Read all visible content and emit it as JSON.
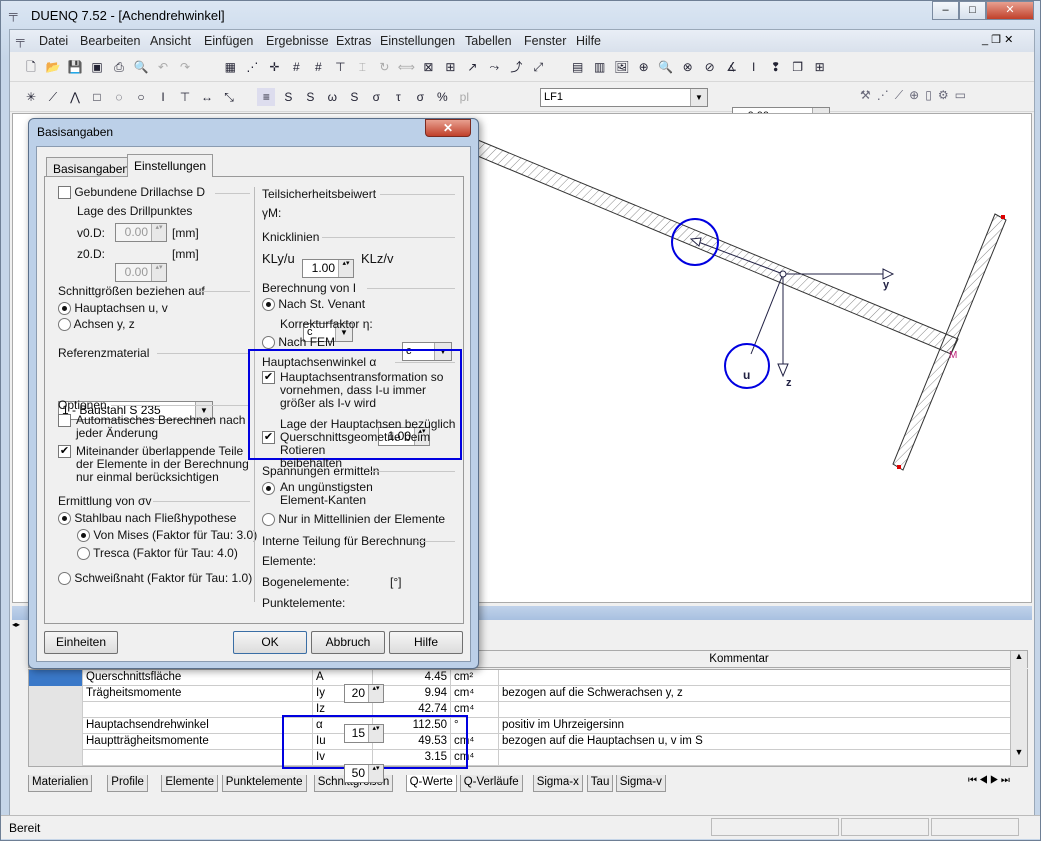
{
  "window": {
    "title": "DUENQ 7.52 - [Achendrehwinkel]",
    "controls": [
      "–",
      "□",
      "✕"
    ]
  },
  "menu": [
    "Datei",
    "Bearbeiten",
    "Ansicht",
    "Einfügen",
    "Ergebnisse",
    "Extras",
    "Einstellungen",
    "Tabellen",
    "Fenster",
    "Hilfe"
  ],
  "toolbar": {
    "loadcase": "LF1",
    "position": "x: 0.00 mm"
  },
  "canvas": {
    "axis_y": "y",
    "axis_z": "z",
    "axis_u": "u",
    "point_m": "M"
  },
  "dialog": {
    "title": "Basisangaben",
    "tabs": [
      "Basisangaben",
      "Einstellungen"
    ],
    "active_tab": "Einstellungen",
    "left": {
      "drill": {
        "label": "Gebundene Drillachse D",
        "checked": false,
        "sub": "Lage des Drillpunktes",
        "v_label": "v0.D:",
        "v_value": "0.00",
        "z_label": "z0.D:",
        "z_value": "0.00",
        "unit": "[mm]"
      },
      "schnitt": {
        "title": "Schnittgrößen beziehen auf",
        "options": [
          "Hauptachsen u, v",
          "Achsen y, z"
        ],
        "selected": 0
      },
      "ref": {
        "title": "Referenzmaterial",
        "value": "1 - Baustahl S 235"
      },
      "optionen": {
        "title": "Optionen",
        "auto": {
          "label1": "Automatisches Berechnen nach",
          "label2": "jeder Änderung",
          "checked": false
        },
        "overlap": {
          "label1": "Miteinander überlappende Teile",
          "label2": "der Elemente in der Berechnung",
          "label3": "nur einmal berücksichtigen",
          "checked": true
        }
      },
      "sigma": {
        "title": "Ermittlung von σv",
        "stahlbau": "Stahlbau nach Fließhypothese",
        "mises": "Von Mises (Faktor für Tau: 3.0)",
        "tresca": "Tresca (Faktor für Tau: 4.0)",
        "schweiss": "Schweißnaht (Faktor für Tau: 1.0)"
      }
    },
    "right": {
      "teil": {
        "title": "Teilsicherheitsbeiwert",
        "label": "γM:",
        "value": "1.00"
      },
      "knick": {
        "title": "Knicklinien",
        "kly": "KLy/u",
        "kly_value": "c",
        "klz": "KLz/v",
        "klz_value": "c"
      },
      "berech": {
        "title": "Berechnung von I",
        "venant": "Nach St. Venant",
        "korr_label": "Korrekturfaktor η:",
        "korr_value": "1.00",
        "fem": "Nach FEM"
      },
      "haupt": {
        "title": "Hauptachsenwinkel α",
        "t1": "Hauptachsentransformation so",
        "t2": "vornehmen, dass I-u immer",
        "t3": "größer als I-v wird",
        "l1": "Lage der Hauptachsen bezüglich",
        "l2": "Querschnittsgeometrie beim Rotieren",
        "l3": "beibehalten"
      },
      "span": {
        "title": "Spannungen ermitteln",
        "o1a": "An ungünstigsten",
        "o1b": "Element-Kanten",
        "o2": "Nur in Mittellinien der Elemente"
      },
      "teilung": {
        "title": "Interne Teilung für Berechnung",
        "elem_label": "Elemente:",
        "elem": "20",
        "bogen_label": "Bogenelemente:",
        "bogen": "15",
        "bogen_unit": "[°]",
        "punkt_label": "Punktelemente:",
        "punkt": "50"
      }
    },
    "buttons": {
      "einheiten": "Einheiten",
      "ok": "OK",
      "abbruch": "Abbruch",
      "hilfe": "Hilfe"
    }
  },
  "table": {
    "comment_header": "Kommentar",
    "rows": [
      {
        "name": "Querschnittsfläche",
        "sym": "A",
        "val": "4.45",
        "unit": "cm²",
        "comment": ""
      },
      {
        "name": "Trägheitsmomente",
        "sym": "Iy",
        "val": "9.94",
        "unit": "cm⁴",
        "comment": "bezogen auf die Schwerachsen y, z"
      },
      {
        "name": "",
        "sym": "Iz",
        "val": "42.74",
        "unit": "cm⁴",
        "comment": ""
      },
      {
        "name": "Hauptachsendrehwinkel",
        "sym": "α",
        "val": "112.50",
        "unit": "°",
        "comment": "positiv im Uhrzeigersinn"
      },
      {
        "name": "Hauptträgheitsmomente",
        "sym": "Iu",
        "val": "49.53",
        "unit": "cm⁴",
        "comment": "bezogen auf die Hauptachsen u, v im S"
      },
      {
        "name": "",
        "sym": "Iv",
        "val": "3.15",
        "unit": "cm⁴",
        "comment": ""
      }
    ],
    "tabs": [
      "Materialien",
      "Profile",
      "Elemente",
      "Punktelemente",
      "Schnittgrößen",
      "Q-Werte",
      "Q-Verläufe",
      "Sigma-x",
      "Tau",
      "Sigma-v"
    ],
    "active_tab": "Q-Werte"
  },
  "status": "Bereit"
}
